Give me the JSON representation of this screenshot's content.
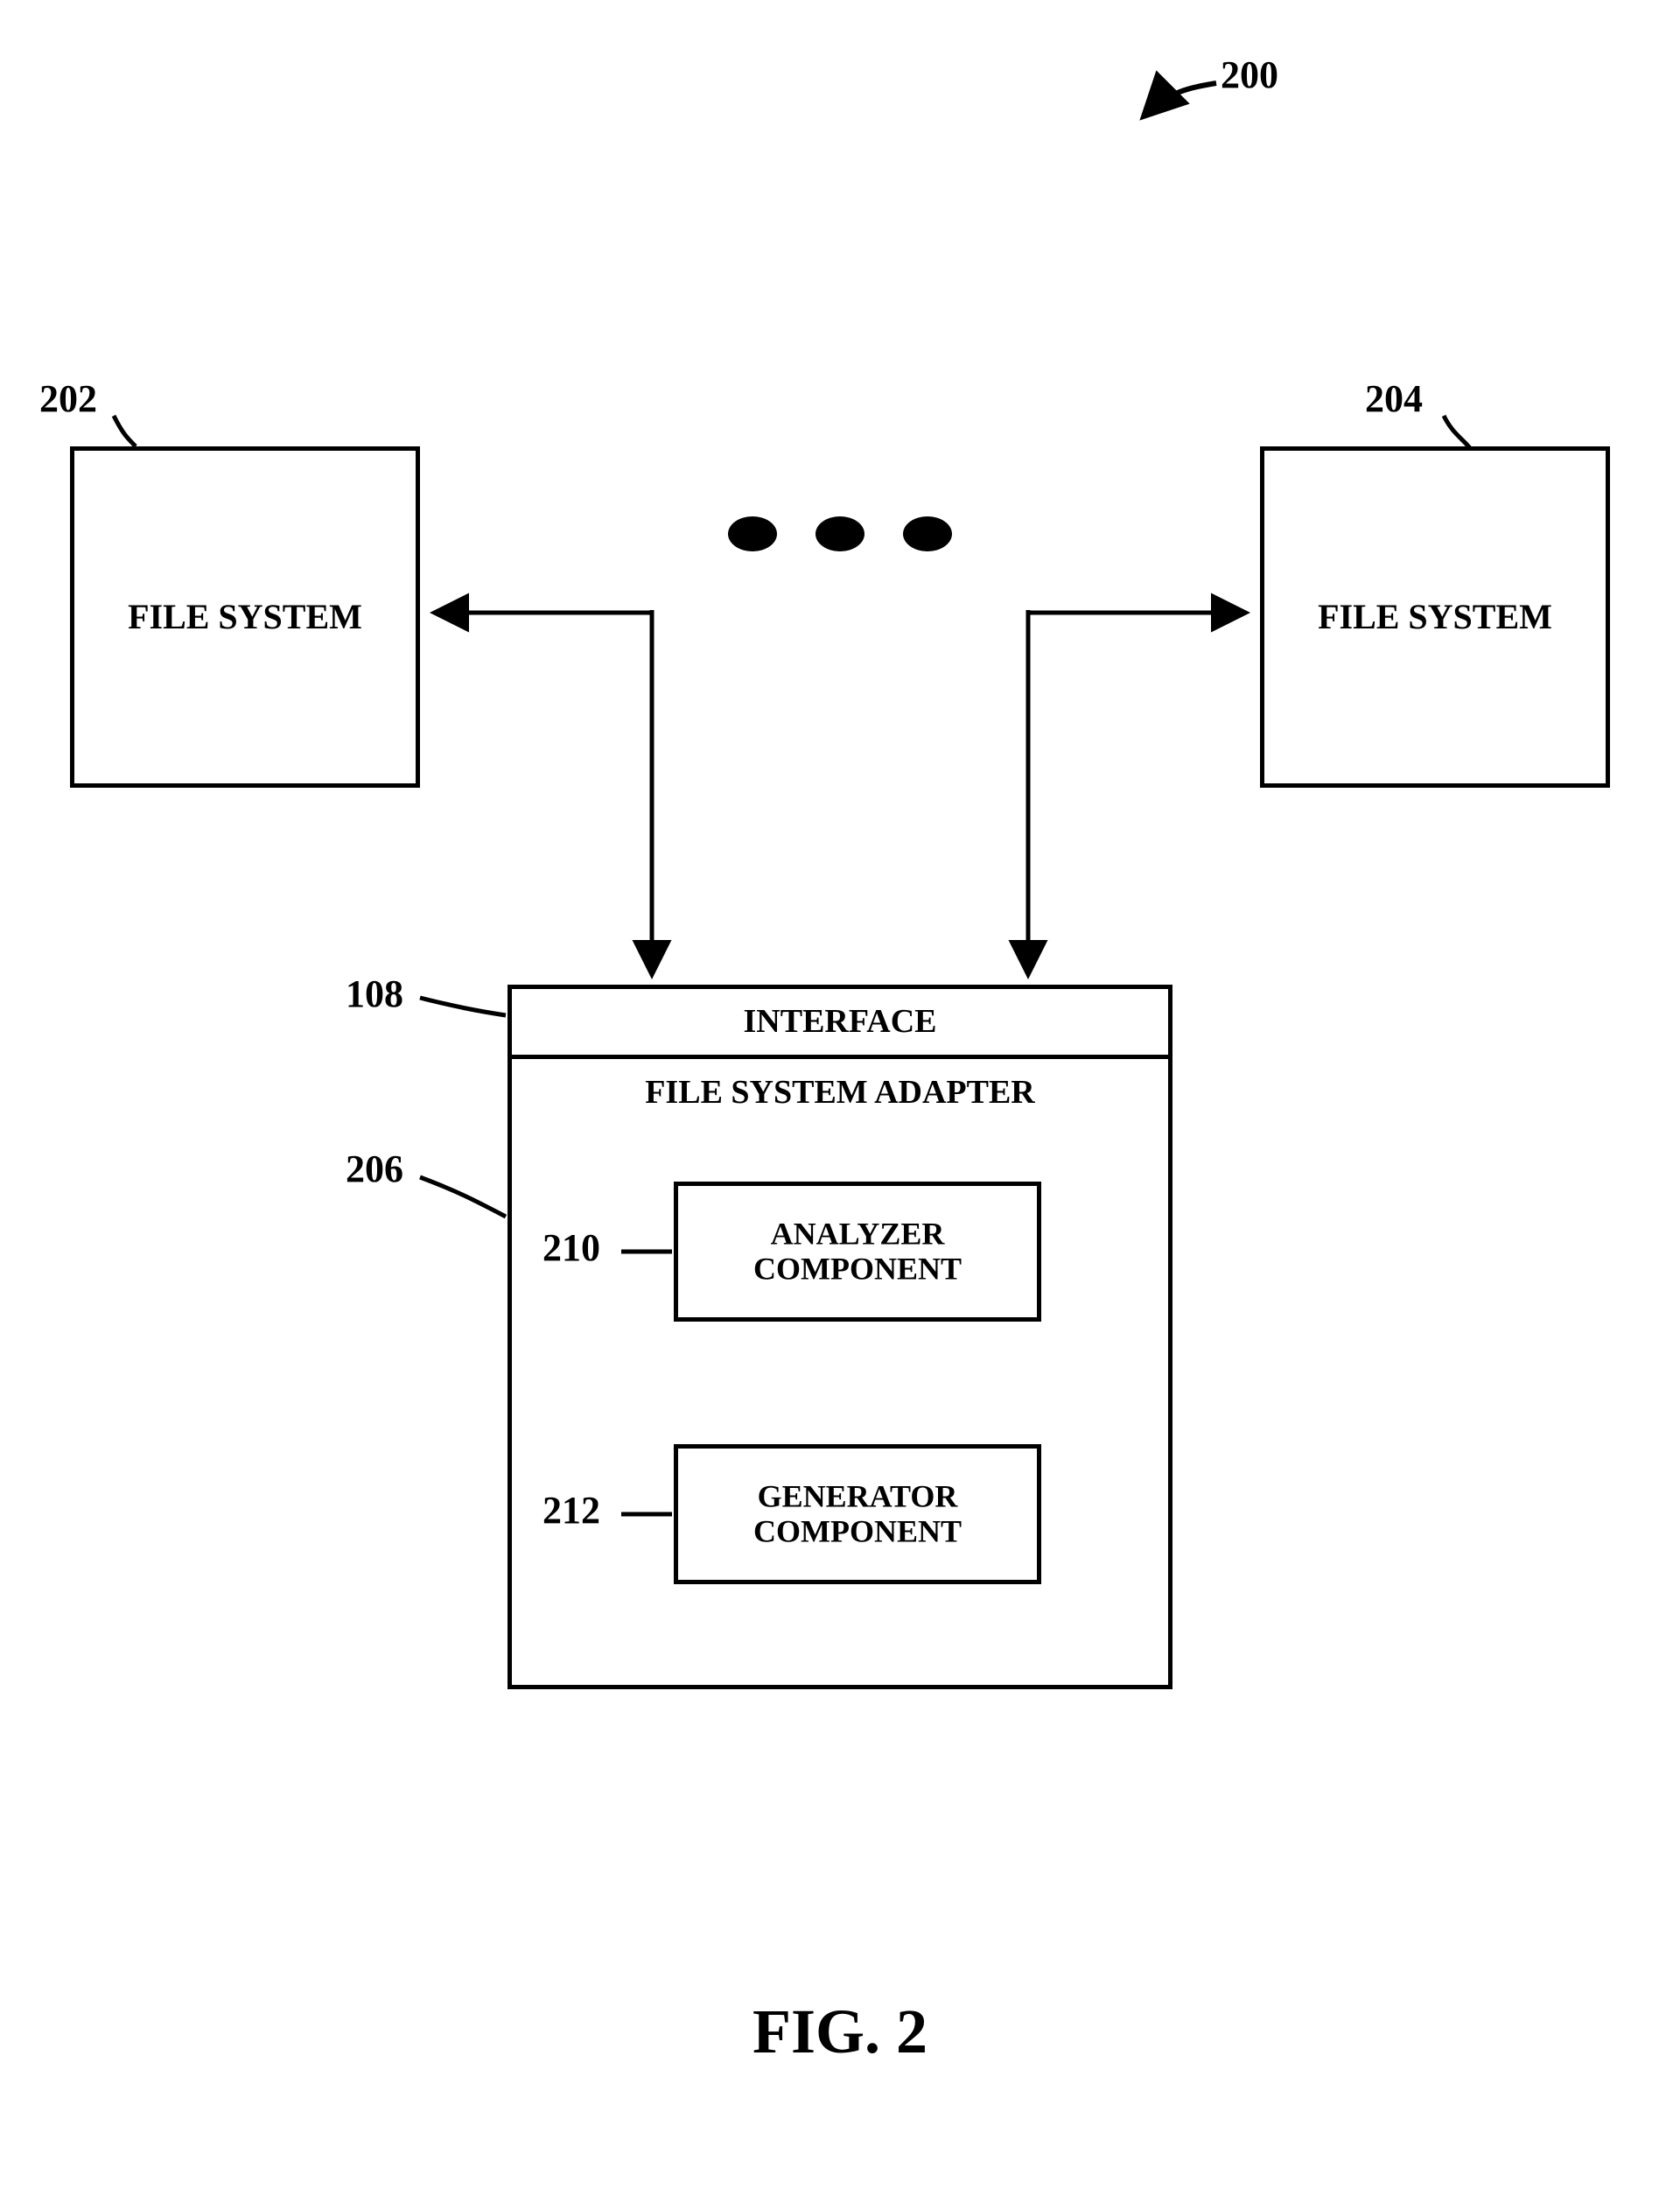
{
  "figure": {
    "number": "200",
    "caption": "FIG. 2"
  },
  "blocks": {
    "file_system_left": {
      "ref": "202",
      "label": "FILE SYSTEM"
    },
    "file_system_right": {
      "ref": "204",
      "label": "FILE SYSTEM"
    },
    "interface": {
      "ref": "108",
      "label": "INTERFACE"
    },
    "adapter": {
      "ref": "206",
      "label": "FILE SYSTEM ADAPTER"
    },
    "analyzer": {
      "ref": "210",
      "label": "ANALYZER COMPONENT"
    },
    "generator": {
      "ref": "212",
      "label": "GENERATOR COMPONENT"
    }
  }
}
